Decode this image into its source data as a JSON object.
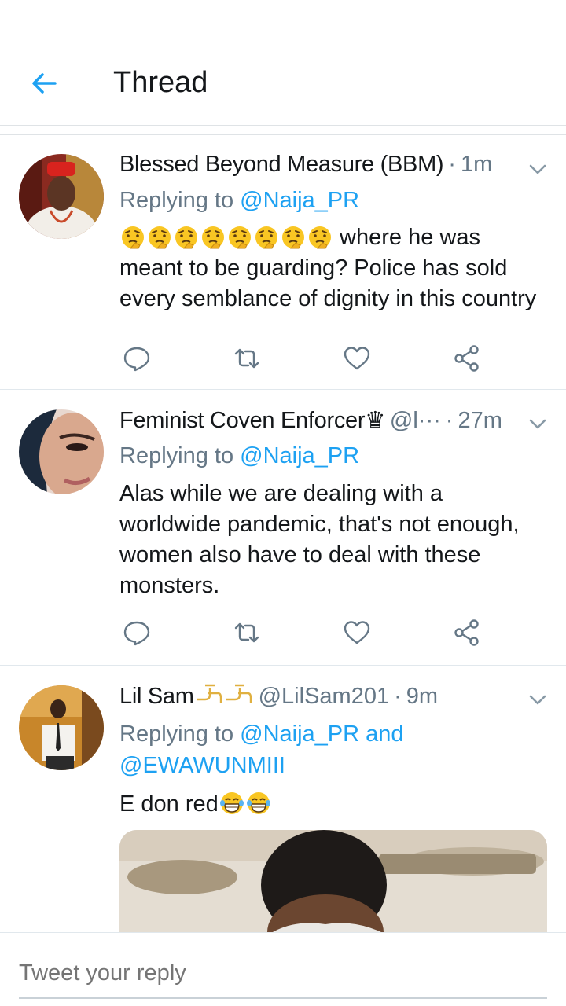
{
  "header": {
    "title": "Thread"
  },
  "colors": {
    "accent": "#1da1f2",
    "text": "#14171a",
    "secondary": "#657786"
  },
  "tweets": [
    {
      "name": "Blessed Beyond Measure (BBM)",
      "handle": "",
      "dot": "·",
      "time": "1m",
      "reply_prefix": "Replying to",
      "reply_mentions": "@Naija_PR",
      "text_after_emoji": " where he was",
      "text_lines": [
        "meant to be guarding? Police has sold",
        "every semblance of dignity in this country"
      ]
    },
    {
      "name": "Feminist Coven Enforcer",
      "name_suffix": "♛",
      "handle": "@l···",
      "dot": "·",
      "time": "27m",
      "reply_prefix": "Replying to",
      "reply_mentions": "@Naija_PR",
      "text_lines": [
        "Alas while we are dealing with a",
        "worldwide pandemic, that's not enough,",
        "women also have to deal with these",
        "monsters."
      ]
    },
    {
      "name": "Lil Sam",
      "handle": "@LilSam201",
      "dot": "·",
      "time": "9m",
      "reply_prefix": "Replying to",
      "reply_mentions_1": "@Naija_PR and",
      "reply_mentions_2": "@EWAWUNMIII",
      "text": "E don red"
    }
  ],
  "compose": {
    "placeholder": "Tweet your reply"
  }
}
